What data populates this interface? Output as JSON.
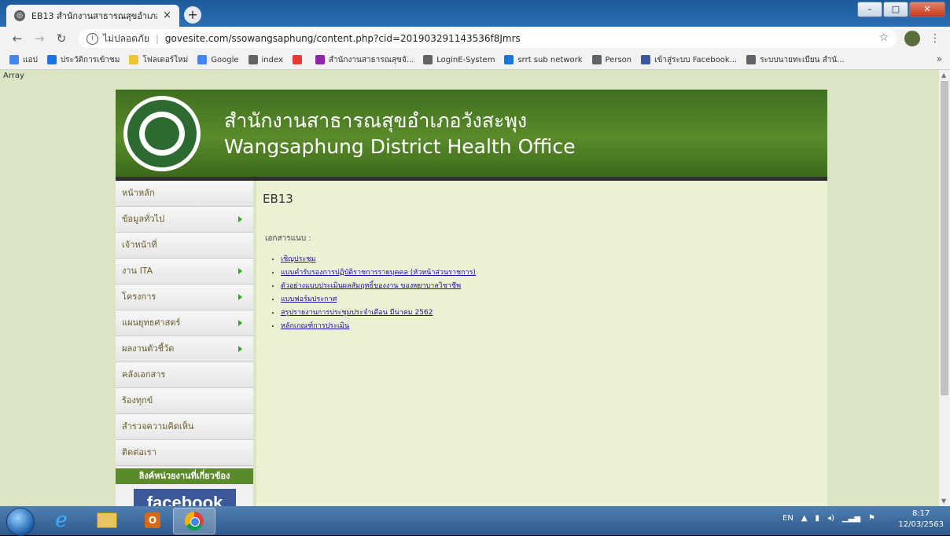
{
  "browser": {
    "tab_title": "EB13 สำนักงานสาธารณสุขอำเภอวังสะ",
    "tab_close": "×",
    "new_tab": "+",
    "security_label": "ไม่ปลอดภัย",
    "url": "govesite.com/ssowangsaphung/content.php?cid=201903291143536f8Jmrs",
    "bookmarks": [
      {
        "label": "แอป",
        "icon": "apps-icon",
        "color": "#4285f4"
      },
      {
        "label": "ประวัติการเข้าชม",
        "icon": "history-icon",
        "color": "#1a73e8"
      },
      {
        "label": "โฟลเดอร์ใหม่",
        "icon": "folder-icon",
        "color": "#f0c330"
      },
      {
        "label": "Google",
        "icon": "google-icon",
        "color": "#4285f4"
      },
      {
        "label": "index",
        "icon": "globe-icon",
        "color": "#5f6368"
      },
      {
        "label": "",
        "icon": "red-app-icon",
        "color": "#e53935"
      },
      {
        "label": "สำนักงานสาธารณสุขจั...",
        "icon": "colorful-icon",
        "color": "#8e24aa"
      },
      {
        "label": "LoginE-System",
        "icon": "globe-icon",
        "color": "#5f6368"
      },
      {
        "label": "srrt sub network",
        "icon": "e-icon",
        "color": "#1976d2"
      },
      {
        "label": "Person",
        "icon": "globe-icon",
        "color": "#5f6368"
      },
      {
        "label": "เข้าสู่ระบบ Facebook...",
        "icon": "facebook-icon",
        "color": "#3b5998"
      },
      {
        "label": "ระบบนายทะเบียน สำนั...",
        "icon": "globe-icon",
        "color": "#5f6368"
      }
    ],
    "more_bookmarks": "»"
  },
  "page": {
    "array_text": "Array",
    "header": {
      "title_th": "สำนักงานสาธารณสุขอำเภอวังสะพุง",
      "title_en": "Wangsaphung District Health Office"
    },
    "sidebar": {
      "items": [
        {
          "label": "หน้าหลัก",
          "has_arrow": false
        },
        {
          "label": "ข้อมูลทั่วไป",
          "has_arrow": true
        },
        {
          "label": "เจ้าหน้าที่",
          "has_arrow": false
        },
        {
          "label": "งาน ITA",
          "has_arrow": true
        },
        {
          "label": "โครงการ",
          "has_arrow": true
        },
        {
          "label": "แผนยุทธศาสตร์",
          "has_arrow": true
        },
        {
          "label": "ผลงานตัวชี้วัด",
          "has_arrow": true
        },
        {
          "label": "คลังเอกสาร",
          "has_arrow": false
        },
        {
          "label": "ร้องทุกข์",
          "has_arrow": false
        },
        {
          "label": "สำรวจความคิดเห็น",
          "has_arrow": false
        },
        {
          "label": "ติดต่อเรา",
          "has_arrow": false
        }
      ],
      "links_heading": "ลิงค์หน่วยงานที่เกี่ยวข้อง",
      "facebook_text": "facebook"
    },
    "content": {
      "heading": "EB13",
      "attachment_label": "เอกสารแนบ :",
      "documents": [
        "เชิญประชุม",
        "แบบคำรับรองการปฏิบัติราชการรายบุคคล (หัวหน้าส่วนราชการ)",
        "ตัวอย่างแบบประเมินผลสัมฤทธิ์ของงาน ของพยาบาลวิชาชีพ",
        "แบบฟอร์มประกาศ",
        "สรุปรายงานการประชุมประจำเดือน มีนาคม 2562",
        "หลักเกณฑ์การประเมิน"
      ]
    }
  },
  "taskbar": {
    "language": "EN",
    "time": "8:17",
    "date": "12/03/2563"
  }
}
